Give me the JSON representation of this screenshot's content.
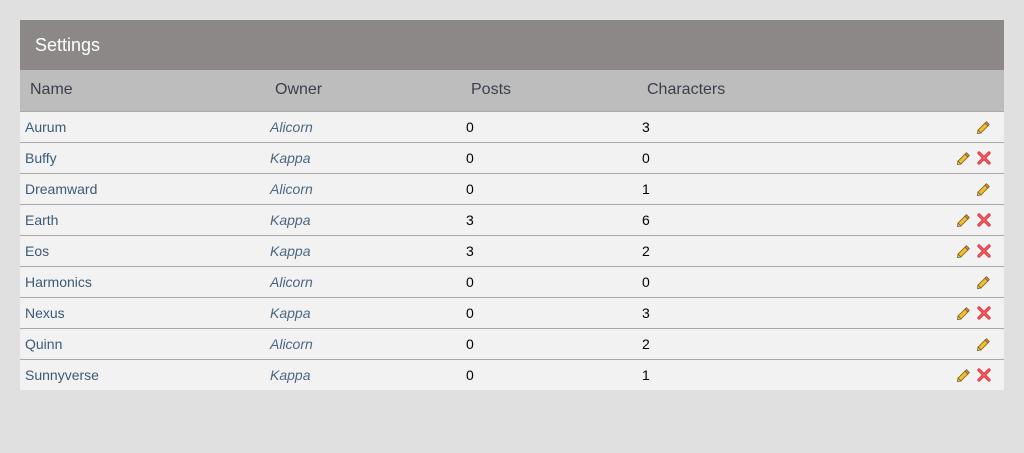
{
  "panel": {
    "title": "Settings"
  },
  "table": {
    "headers": {
      "name": "Name",
      "owner": "Owner",
      "posts": "Posts",
      "characters": "Characters"
    },
    "rows": [
      {
        "name": "Aurum",
        "owner": "Alicorn",
        "posts": "0",
        "characters": "3",
        "deletable": false
      },
      {
        "name": "Buffy",
        "owner": "Kappa",
        "posts": "0",
        "characters": "0",
        "deletable": true
      },
      {
        "name": "Dreamward",
        "owner": "Alicorn",
        "posts": "0",
        "characters": "1",
        "deletable": false
      },
      {
        "name": "Earth",
        "owner": "Kappa",
        "posts": "3",
        "characters": "6",
        "deletable": true
      },
      {
        "name": "Eos",
        "owner": "Kappa",
        "posts": "3",
        "characters": "2",
        "deletable": true
      },
      {
        "name": "Harmonics",
        "owner": "Alicorn",
        "posts": "0",
        "characters": "0",
        "deletable": false
      },
      {
        "name": "Nexus",
        "owner": "Kappa",
        "posts": "0",
        "characters": "3",
        "deletable": true
      },
      {
        "name": "Quinn",
        "owner": "Alicorn",
        "posts": "0",
        "characters": "2",
        "deletable": false
      },
      {
        "name": "Sunnyverse",
        "owner": "Kappa",
        "posts": "0",
        "characters": "1",
        "deletable": true
      }
    ]
  },
  "icons": {
    "edit": "pencil-icon",
    "delete": "delete-x-icon"
  },
  "colors": {
    "header_bg": "#8c8888",
    "column_header_bg": "#bdbdbd",
    "row_bg": "#f2f2f2",
    "link_text": "#3b5a78",
    "delete_red": "#e0303a",
    "pencil_yellow": "#f0c030"
  }
}
